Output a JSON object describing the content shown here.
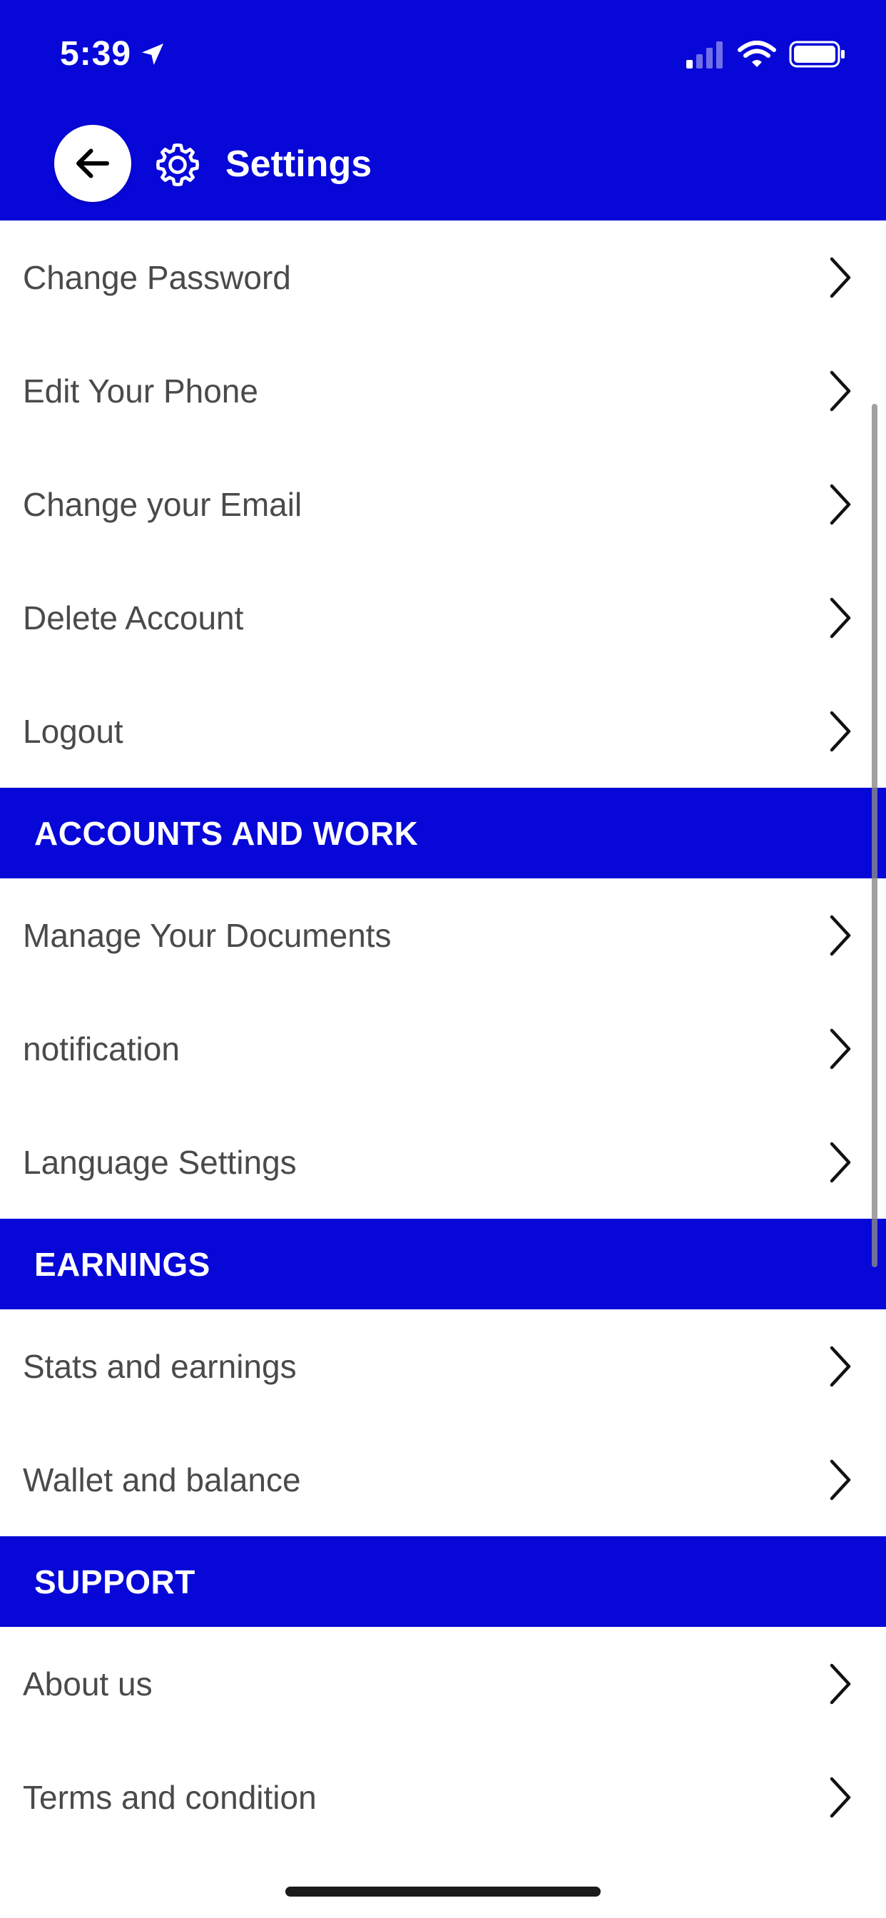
{
  "status_bar": {
    "time": "5:39"
  },
  "header": {
    "title": "Settings"
  },
  "sections": [
    {
      "title": "",
      "items": [
        "Change Password",
        "Edit Your Phone",
        "Change your Email",
        "Delete Account",
        "Logout"
      ]
    },
    {
      "title": "ACCOUNTS AND WORK",
      "items": [
        "Manage Your Documents",
        "notification",
        "Language Settings"
      ]
    },
    {
      "title": "EARNINGS",
      "items": [
        "Stats and earnings",
        "Wallet and balance"
      ]
    },
    {
      "title": "SUPPORT",
      "items": [
        "About us",
        "Terms and condition"
      ]
    }
  ],
  "colors": {
    "brand": "#0707D8",
    "text": "#4a4a4a"
  },
  "icons": {
    "back": "arrow-left-icon",
    "settings": "gear-icon",
    "row": "chevron-right-icon"
  }
}
